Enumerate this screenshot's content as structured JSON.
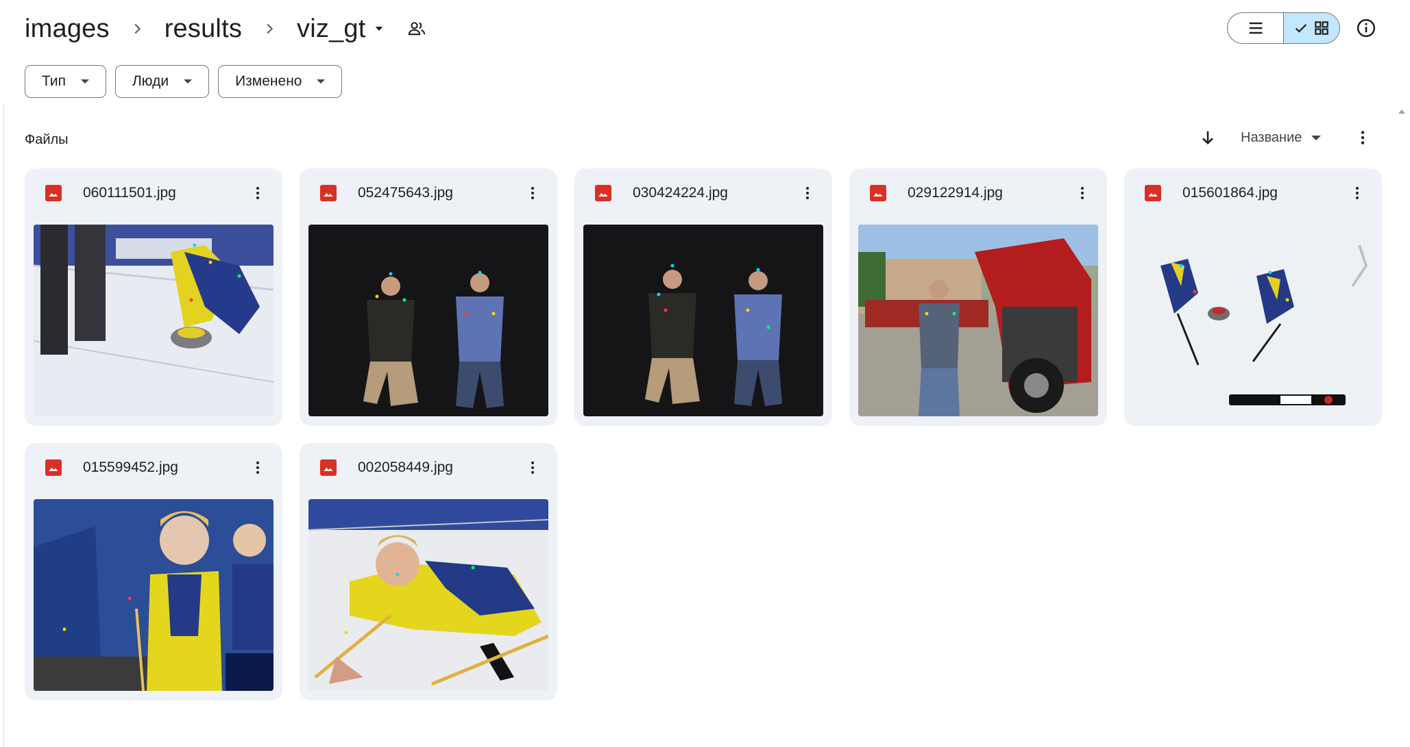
{
  "breadcrumb": {
    "items": [
      "images",
      "results"
    ],
    "current": "viz_gt"
  },
  "filters": [
    "Тип",
    "Люди",
    "Изменено"
  ],
  "section": {
    "title": "Файлы",
    "sort_label": "Название"
  },
  "view_toggle": {
    "active": "grid"
  },
  "files": [
    {
      "name": "060111501.jpg",
      "scene": "curling-ice"
    },
    {
      "name": "052475643.jpg",
      "scene": "studio-dark"
    },
    {
      "name": "030424224.jpg",
      "scene": "studio-dark"
    },
    {
      "name": "029122914.jpg",
      "scene": "truck-outdoor"
    },
    {
      "name": "015601864.jpg",
      "scene": "curling-overhead"
    },
    {
      "name": "015599452.jpg",
      "scene": "curling-crowd"
    },
    {
      "name": "002058449.jpg",
      "scene": "curling-slide"
    }
  ],
  "icons": {
    "breadcrumb_separator": "chevron-right-icon",
    "folder_menu": "caret-down-icon",
    "shared": "people-icon",
    "list_view": "list-view-icon",
    "grid_view": "grid-view-icon",
    "checkmark": "check-icon",
    "info": "info-icon",
    "sort_direction": "arrow-down-icon",
    "more": "more-vert-icon",
    "file_type": "image-file-icon"
  },
  "colors": {
    "accent": "#c2e7ff",
    "card_bg": "#eef1f6",
    "image_icon": "#d93025"
  }
}
